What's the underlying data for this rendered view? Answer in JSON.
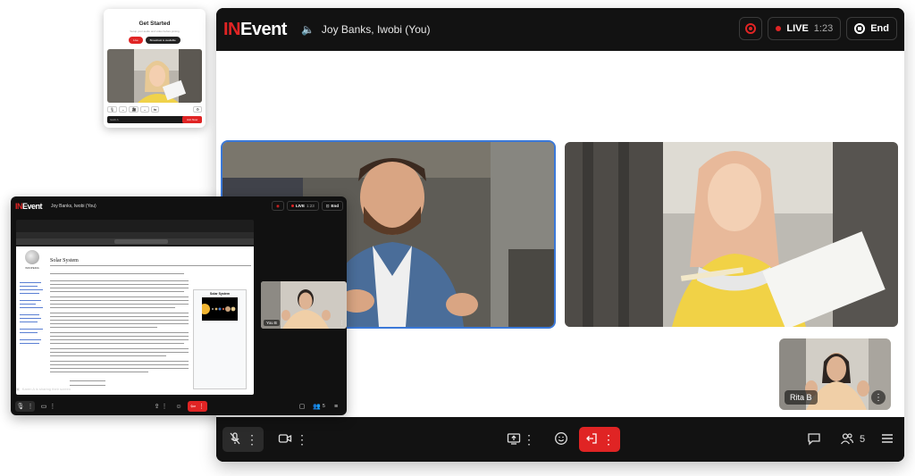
{
  "brand": {
    "logo_prefix": "IN",
    "logo_suffix": "Event",
    "accent": "#e02424"
  },
  "main_window": {
    "participants_title": "Joy Banks, Iwobi (You)",
    "live_label": "LIVE",
    "live_time": "1:23",
    "end_label": "End",
    "tiles": [
      {
        "name": "speaker-man",
        "speaking": true
      },
      {
        "name": "speaker-woman",
        "speaking": false
      },
      {
        "name": "Rita B",
        "speaking": false
      }
    ],
    "toolbar": {
      "participants_count": "5"
    }
  },
  "get_started": {
    "title": "Get Started",
    "subtitle": "Setup your audio and video before joining",
    "primary_btn": "Live",
    "secondary_btn": "Broadcast is available",
    "name_placeholder": "Iwobi A",
    "join_label": "Join Now",
    "mini_ctrls": [
      "🎙",
      "⌄",
      "🎥",
      "⌄",
      "⇆"
    ]
  },
  "small_window": {
    "participants_title": "Joy Banks, Iwobi (You)",
    "live_label": "LIVE",
    "live_time": "1:23",
    "end_label": "End",
    "side_tile_name": "You B",
    "sharing_text": "Karen A is sharing their screen",
    "participants_count": "5",
    "wiki_title": "Solar System",
    "wiki_logo_text": "WIKIPEDIA",
    "infobox_title": "Solar System"
  }
}
